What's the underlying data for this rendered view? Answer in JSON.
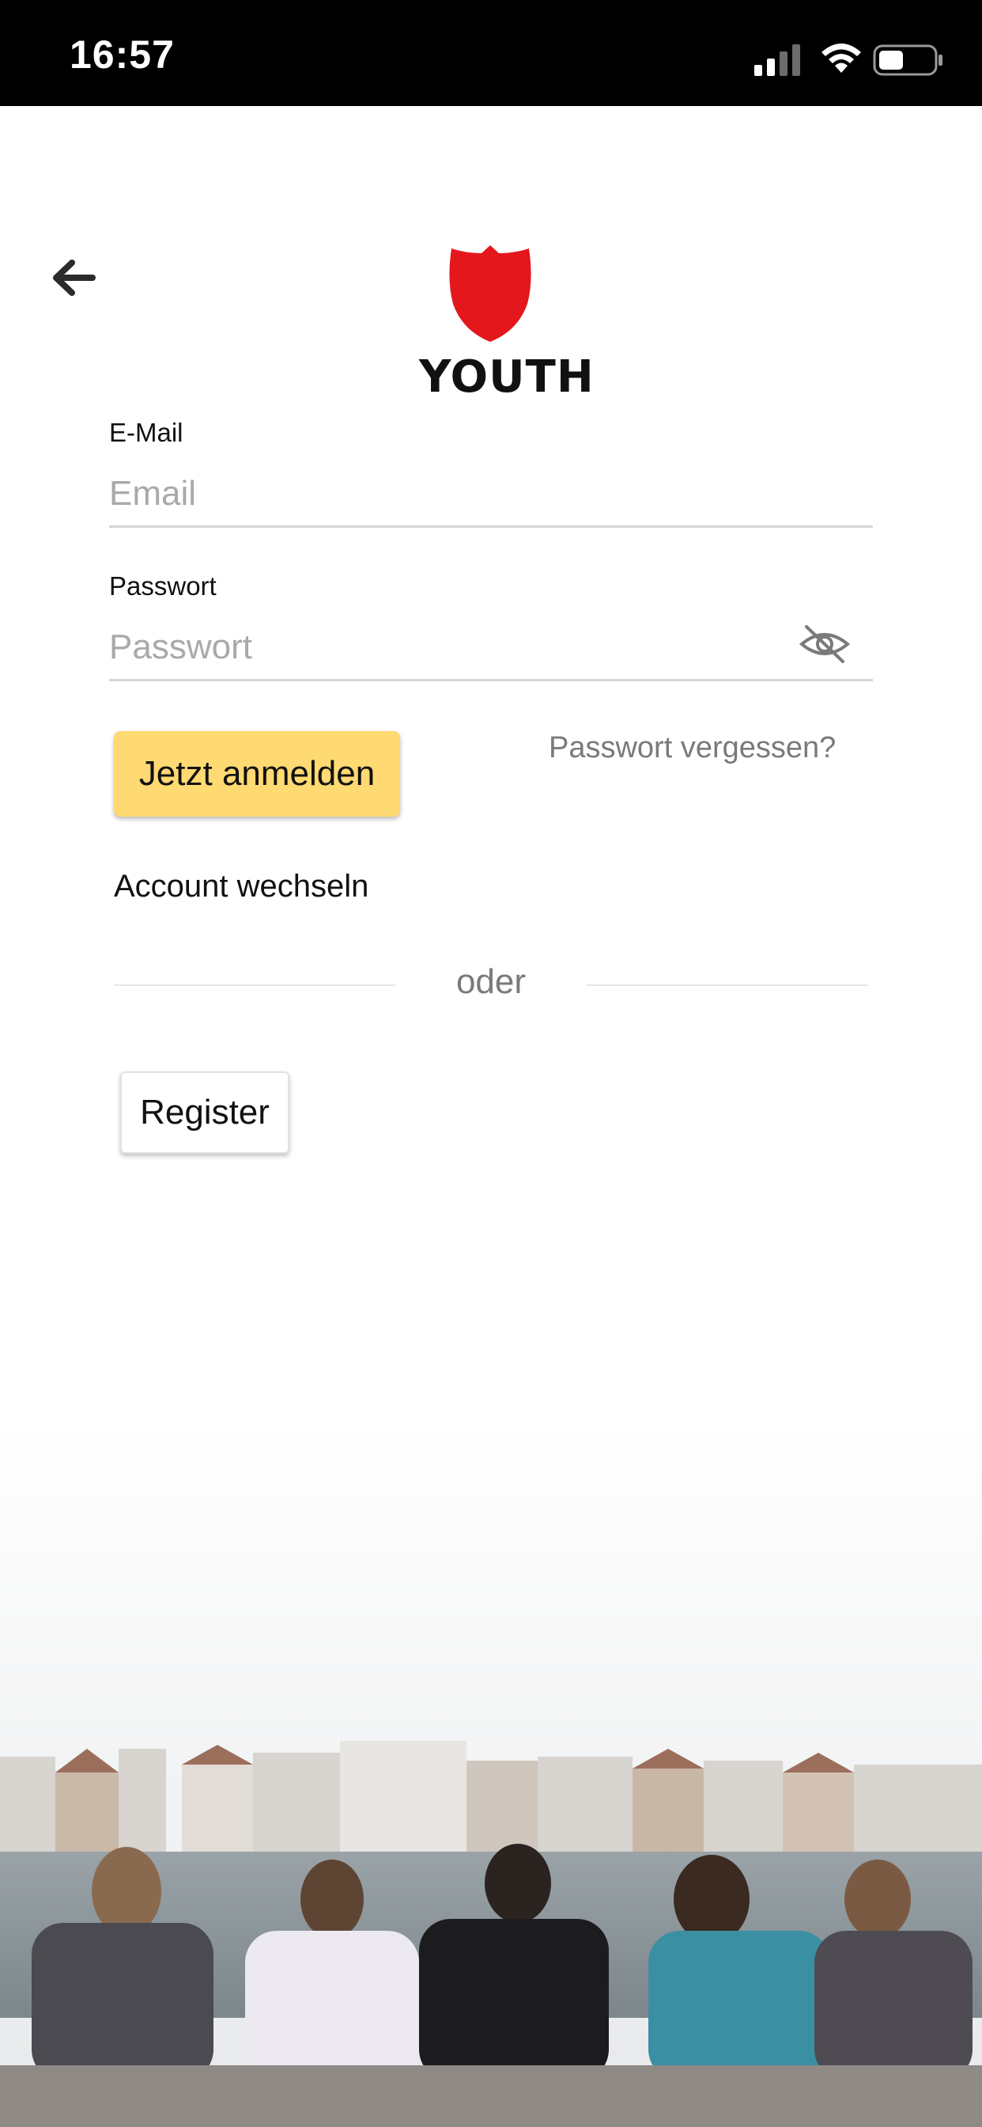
{
  "status_bar": {
    "time": "16:57",
    "icons": [
      "signal-icon",
      "wifi-icon",
      "battery-icon"
    ]
  },
  "header": {
    "back_icon": "arrow-left-icon",
    "logo_text": "YOUTH",
    "logo_color": "#e4171d"
  },
  "form": {
    "email": {
      "label": "E-Mail",
      "placeholder": "Email",
      "value": ""
    },
    "password": {
      "label": "Passwort",
      "placeholder": "Passwort",
      "value": "",
      "toggle_icon": "eye-off-icon"
    },
    "login_label": "Jetzt anmelden",
    "forgot_label": "Passwort vergessen?",
    "switch_account_label": "Account wechseln",
    "divider_label": "oder",
    "register_label": "Register"
  },
  "colors": {
    "accent_yellow": "#ffd971",
    "muted_text": "#7a7a7a",
    "background": "#ffffff"
  }
}
